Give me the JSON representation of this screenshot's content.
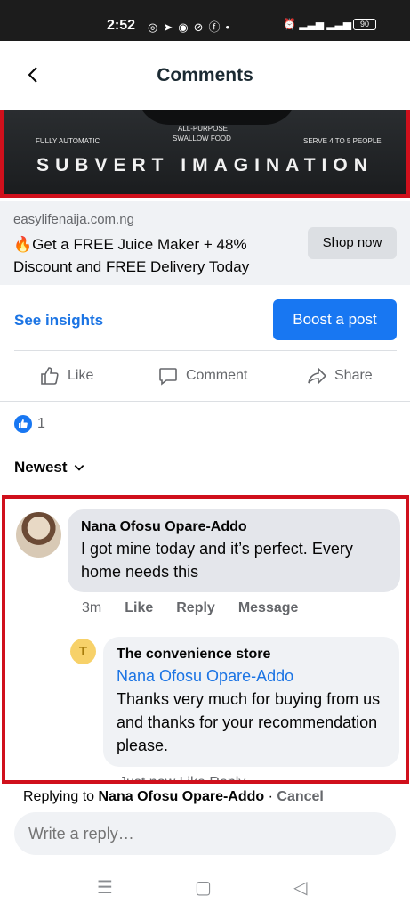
{
  "status": {
    "time": "2:52",
    "battery": "90"
  },
  "header": {
    "title": "Comments"
  },
  "ad": {
    "banner": {
      "left_caption": "FULLY AUTOMATIC",
      "center_caption_1": "ALL-PURPOSE",
      "center_caption_2": "SWALLOW FOOD",
      "right_caption": "SERVE 4 TO 5 PEOPLE",
      "tagline": "SUBVERT IMAGINATION"
    },
    "domain": "easylifenaija.com.ng",
    "title": "🔥Get a FREE  Juice Maker + 48% Discount and FREE Delivery Today",
    "cta": "Shop now"
  },
  "post_actions": {
    "insights": "See insights",
    "boost": "Boost a post",
    "like": "Like",
    "comment": "Comment",
    "share": "Share"
  },
  "reactions": {
    "count": "1"
  },
  "sort": {
    "label": "Newest"
  },
  "comments": [
    {
      "author": "Nana Ofosu Opare-Addo",
      "text": "I got mine today and it’s perfect. Every home needs this",
      "time": "3m",
      "like": "Like",
      "reply": "Reply",
      "message": "Message",
      "replies": [
        {
          "avatar_letter": "T",
          "author": "The convenience store",
          "mention": "Nana Ofosu Opare-Addo",
          "text": "Thanks very much for buying from us and thanks for your recommendation please.",
          "meta_partial": "Just now   Like   Reply"
        }
      ]
    }
  ],
  "reply_bar": {
    "prefix": "Replying to",
    "target": "Nana Ofosu Opare-Addo",
    "separator": " · ",
    "cancel": "Cancel",
    "placeholder": "Write a reply…"
  }
}
